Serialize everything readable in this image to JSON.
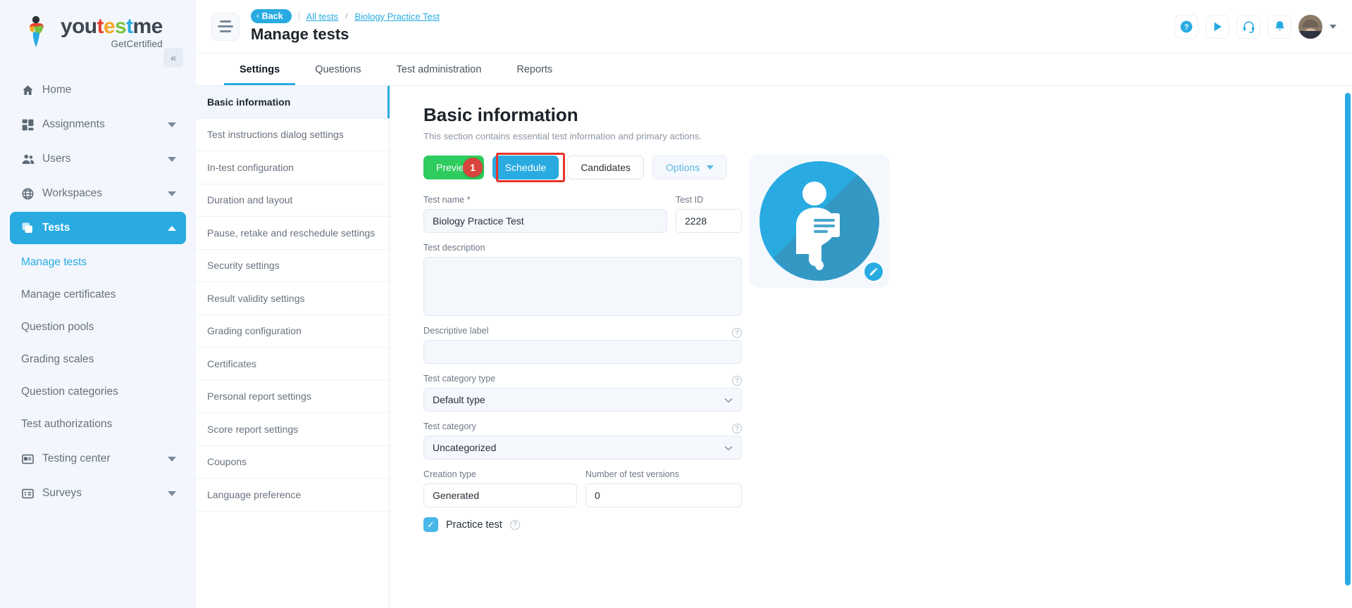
{
  "brand": {
    "name_parts": [
      "you",
      "t",
      "e",
      "s",
      "t",
      "me"
    ],
    "tagline": "GetCertified",
    "collapse_icon": "«",
    "accent": "#29abe2"
  },
  "sidebar": {
    "items": [
      {
        "label": "Home",
        "icon": "home-icon",
        "type": "item",
        "active": false,
        "expandable": false
      },
      {
        "label": "Assignments",
        "icon": "grid-icon",
        "type": "item",
        "active": false,
        "expandable": true
      },
      {
        "label": "Users",
        "icon": "users-icon",
        "type": "item",
        "active": false,
        "expandable": true
      },
      {
        "label": "Workspaces",
        "icon": "globe-icon",
        "type": "item",
        "active": false,
        "expandable": true
      },
      {
        "label": "Tests",
        "icon": "layers-icon",
        "type": "item",
        "active": true,
        "expandable": true
      },
      {
        "label": "Manage tests",
        "type": "sub",
        "active": true
      },
      {
        "label": "Manage certificates",
        "type": "sub",
        "active": false
      },
      {
        "label": "Question pools",
        "type": "sub",
        "active": false
      },
      {
        "label": "Grading scales",
        "type": "sub",
        "active": false
      },
      {
        "label": "Question categories",
        "type": "sub",
        "active": false
      },
      {
        "label": "Test authorizations",
        "type": "sub",
        "active": false
      },
      {
        "label": "Testing center",
        "icon": "card-icon",
        "type": "item",
        "active": false,
        "expandable": true
      },
      {
        "label": "Surveys",
        "icon": "survey-icon",
        "type": "item",
        "active": false,
        "expandable": true
      }
    ]
  },
  "topbar": {
    "menu_icon": "hamburger-icon",
    "back_label": "Back",
    "back_chevron": "‹",
    "breadcrumb": [
      {
        "label": "All tests"
      },
      {
        "label": "Biology Practice Test"
      }
    ],
    "breadcrumb_separator": "/",
    "page_title": "Manage tests",
    "actions": [
      {
        "name": "help-icon",
        "glyph": "?"
      },
      {
        "name": "play-icon",
        "glyph": "▶"
      },
      {
        "name": "headset-icon",
        "glyph": "♪"
      },
      {
        "name": "bell-icon",
        "glyph": "●"
      }
    ]
  },
  "tabs": [
    {
      "label": "Settings",
      "active": true
    },
    {
      "label": "Questions",
      "active": false
    },
    {
      "label": "Test administration",
      "active": false
    },
    {
      "label": "Reports",
      "active": false
    }
  ],
  "settings_list": [
    {
      "label": "Basic information",
      "active": true
    },
    {
      "label": "Test instructions dialog settings",
      "active": false
    },
    {
      "label": "In-test configuration",
      "active": false
    },
    {
      "label": "Duration and layout",
      "active": false
    },
    {
      "label": "Pause, retake and reschedule settings",
      "active": false
    },
    {
      "label": "Security settings",
      "active": false
    },
    {
      "label": "Result validity settings",
      "active": false
    },
    {
      "label": "Grading configuration",
      "active": false
    },
    {
      "label": "Certificates",
      "active": false
    },
    {
      "label": "Personal report settings",
      "active": false
    },
    {
      "label": "Score report settings",
      "active": false
    },
    {
      "label": "Coupons",
      "active": false
    },
    {
      "label": "Language preference",
      "active": false
    }
  ],
  "content": {
    "section_title": "Basic information",
    "section_subtitle": "This section contains essential test information and primary actions.",
    "buttons": {
      "preview": "Preview",
      "schedule": "Schedule",
      "candidates": "Candidates",
      "options": "Options"
    },
    "annotation": {
      "step_number": "1",
      "highlight_color": "#e8342a",
      "badge_color": "#d9443c",
      "target": "schedule-button"
    },
    "fields": {
      "test_name_label": "Test name *",
      "test_name_value": "Biology Practice Test",
      "test_id_label": "Test ID",
      "test_id_value": "2228",
      "test_description_label": "Test description",
      "test_description_value": "",
      "descriptive_label_label": "Descriptive label",
      "descriptive_label_value": "",
      "test_category_type_label": "Test category type",
      "test_category_type_value": "Default type",
      "test_category_label": "Test category",
      "test_category_value": "Uncategorized",
      "creation_type_label": "Creation type",
      "creation_type_value": "Generated",
      "num_versions_label": "Number of test versions",
      "num_versions_value": "0",
      "practice_test_label": "Practice test",
      "practice_test_checked": true
    },
    "image_card": {
      "icon_name": "test-question-person-icon",
      "edit_icon": "pencil-icon"
    },
    "help_icon_glyph": "?",
    "check_glyph": "✓",
    "select_chevron": "⌄"
  }
}
